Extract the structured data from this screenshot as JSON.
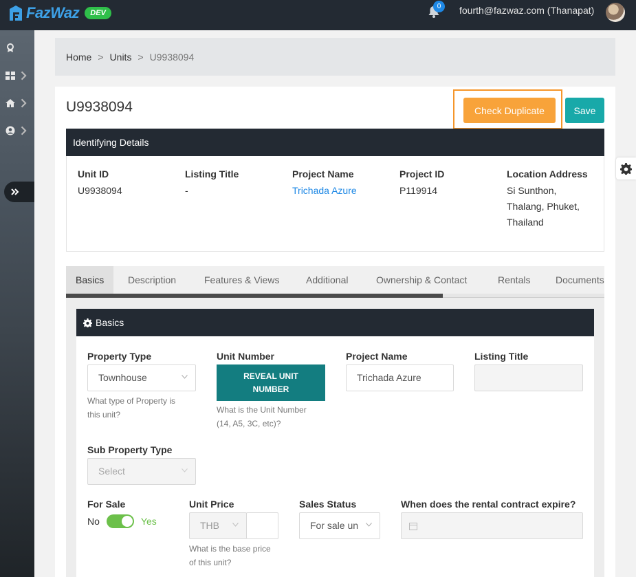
{
  "app": {
    "logo_text": "FazWaz",
    "env_badge": "DEV"
  },
  "header": {
    "notification_count": "0",
    "user_label": "fourth@fazwaz.com (Thanapat)"
  },
  "breadcrumb": {
    "items": [
      "Home",
      "Units",
      "U9938094"
    ],
    "separator": ">"
  },
  "page": {
    "title": "U9938094",
    "check_duplicate_label": "Check Duplicate",
    "save_label": "Save"
  },
  "identifying": {
    "header": "Identifying Details",
    "unit_id_label": "Unit ID",
    "unit_id": "U9938094",
    "listing_title_label": "Listing Title",
    "listing_title": "-",
    "project_name_label": "Project Name",
    "project_name": "Trichada Azure",
    "project_id_label": "Project ID",
    "project_id": "P119914",
    "location_label": "Location Address",
    "location_lines": [
      "Si Sunthon,",
      "Thalang, Phuket,",
      "Thailand"
    ]
  },
  "tabs": {
    "items": [
      "Basics",
      "Description",
      "Features & Views",
      "Additional",
      "Ownership & Contact",
      "Rentals",
      "Documents"
    ],
    "active": "Basics",
    "progress_fraction": 0.7
  },
  "basics": {
    "header": "Basics",
    "property_type": {
      "label": "Property Type",
      "value": "Townhouse",
      "help": [
        "What type of Property is",
        "this unit?"
      ]
    },
    "unit_number": {
      "label": "Unit Number",
      "button_lines": [
        "REVEAL UNIT",
        "NUMBER"
      ],
      "help": [
        "What is the Unit Number",
        "(14, A5, 3C, etc)?"
      ]
    },
    "project_name": {
      "label": "Project Name",
      "value": "Trichada Azure"
    },
    "listing_title": {
      "label": "Listing Title",
      "value": ""
    },
    "sub_property_type": {
      "label": "Sub Property Type",
      "value": "Select"
    },
    "for_sale": {
      "label": "For Sale",
      "off_label": "No",
      "on_label": "Yes",
      "on": true
    },
    "unit_price": {
      "label": "Unit Price",
      "currency": "THB",
      "value": "",
      "help": [
        "What is the base price",
        "of this unit?"
      ]
    },
    "sales_status": {
      "label": "Sales Status",
      "value": "For sale un"
    },
    "rental_expiry": {
      "label": "When does the rental contract expire?",
      "value": ""
    }
  },
  "colors": {
    "accent_orange": "#f8a33a",
    "save_teal": "#18a9a9",
    "reveal_teal": "#137d80",
    "toggle_green": "#6cc04a",
    "link_blue": "#1e88e5"
  }
}
